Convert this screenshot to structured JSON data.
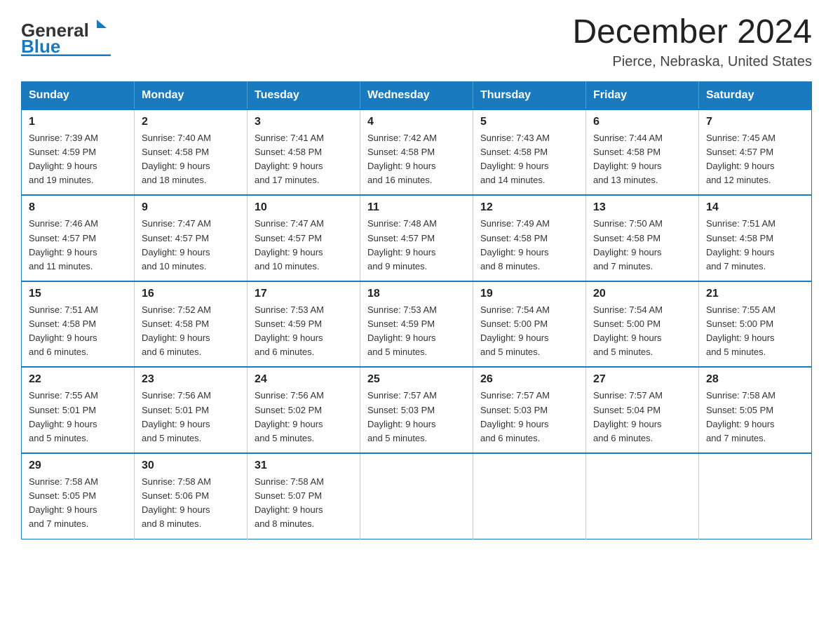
{
  "header": {
    "logo_text_black": "General",
    "logo_text_blue": "Blue",
    "main_title": "December 2024",
    "subtitle": "Pierce, Nebraska, United States"
  },
  "calendar": {
    "days_of_week": [
      "Sunday",
      "Monday",
      "Tuesday",
      "Wednesday",
      "Thursday",
      "Friday",
      "Saturday"
    ],
    "weeks": [
      [
        {
          "num": "1",
          "sunrise": "7:39 AM",
          "sunset": "4:59 PM",
          "daylight": "9 hours and 19 minutes."
        },
        {
          "num": "2",
          "sunrise": "7:40 AM",
          "sunset": "4:58 PM",
          "daylight": "9 hours and 18 minutes."
        },
        {
          "num": "3",
          "sunrise": "7:41 AM",
          "sunset": "4:58 PM",
          "daylight": "9 hours and 17 minutes."
        },
        {
          "num": "4",
          "sunrise": "7:42 AM",
          "sunset": "4:58 PM",
          "daylight": "9 hours and 16 minutes."
        },
        {
          "num": "5",
          "sunrise": "7:43 AM",
          "sunset": "4:58 PM",
          "daylight": "9 hours and 14 minutes."
        },
        {
          "num": "6",
          "sunrise": "7:44 AM",
          "sunset": "4:58 PM",
          "daylight": "9 hours and 13 minutes."
        },
        {
          "num": "7",
          "sunrise": "7:45 AM",
          "sunset": "4:57 PM",
          "daylight": "9 hours and 12 minutes."
        }
      ],
      [
        {
          "num": "8",
          "sunrise": "7:46 AM",
          "sunset": "4:57 PM",
          "daylight": "9 hours and 11 minutes."
        },
        {
          "num": "9",
          "sunrise": "7:47 AM",
          "sunset": "4:57 PM",
          "daylight": "9 hours and 10 minutes."
        },
        {
          "num": "10",
          "sunrise": "7:47 AM",
          "sunset": "4:57 PM",
          "daylight": "9 hours and 10 minutes."
        },
        {
          "num": "11",
          "sunrise": "7:48 AM",
          "sunset": "4:57 PM",
          "daylight": "9 hours and 9 minutes."
        },
        {
          "num": "12",
          "sunrise": "7:49 AM",
          "sunset": "4:58 PM",
          "daylight": "9 hours and 8 minutes."
        },
        {
          "num": "13",
          "sunrise": "7:50 AM",
          "sunset": "4:58 PM",
          "daylight": "9 hours and 7 minutes."
        },
        {
          "num": "14",
          "sunrise": "7:51 AM",
          "sunset": "4:58 PM",
          "daylight": "9 hours and 7 minutes."
        }
      ],
      [
        {
          "num": "15",
          "sunrise": "7:51 AM",
          "sunset": "4:58 PM",
          "daylight": "9 hours and 6 minutes."
        },
        {
          "num": "16",
          "sunrise": "7:52 AM",
          "sunset": "4:58 PM",
          "daylight": "9 hours and 6 minutes."
        },
        {
          "num": "17",
          "sunrise": "7:53 AM",
          "sunset": "4:59 PM",
          "daylight": "9 hours and 6 minutes."
        },
        {
          "num": "18",
          "sunrise": "7:53 AM",
          "sunset": "4:59 PM",
          "daylight": "9 hours and 5 minutes."
        },
        {
          "num": "19",
          "sunrise": "7:54 AM",
          "sunset": "5:00 PM",
          "daylight": "9 hours and 5 minutes."
        },
        {
          "num": "20",
          "sunrise": "7:54 AM",
          "sunset": "5:00 PM",
          "daylight": "9 hours and 5 minutes."
        },
        {
          "num": "21",
          "sunrise": "7:55 AM",
          "sunset": "5:00 PM",
          "daylight": "9 hours and 5 minutes."
        }
      ],
      [
        {
          "num": "22",
          "sunrise": "7:55 AM",
          "sunset": "5:01 PM",
          "daylight": "9 hours and 5 minutes."
        },
        {
          "num": "23",
          "sunrise": "7:56 AM",
          "sunset": "5:01 PM",
          "daylight": "9 hours and 5 minutes."
        },
        {
          "num": "24",
          "sunrise": "7:56 AM",
          "sunset": "5:02 PM",
          "daylight": "9 hours and 5 minutes."
        },
        {
          "num": "25",
          "sunrise": "7:57 AM",
          "sunset": "5:03 PM",
          "daylight": "9 hours and 5 minutes."
        },
        {
          "num": "26",
          "sunrise": "7:57 AM",
          "sunset": "5:03 PM",
          "daylight": "9 hours and 6 minutes."
        },
        {
          "num": "27",
          "sunrise": "7:57 AM",
          "sunset": "5:04 PM",
          "daylight": "9 hours and 6 minutes."
        },
        {
          "num": "28",
          "sunrise": "7:58 AM",
          "sunset": "5:05 PM",
          "daylight": "9 hours and 7 minutes."
        }
      ],
      [
        {
          "num": "29",
          "sunrise": "7:58 AM",
          "sunset": "5:05 PM",
          "daylight": "9 hours and 7 minutes."
        },
        {
          "num": "30",
          "sunrise": "7:58 AM",
          "sunset": "5:06 PM",
          "daylight": "9 hours and 8 minutes."
        },
        {
          "num": "31",
          "sunrise": "7:58 AM",
          "sunset": "5:07 PM",
          "daylight": "9 hours and 8 minutes."
        },
        null,
        null,
        null,
        null
      ]
    ]
  }
}
